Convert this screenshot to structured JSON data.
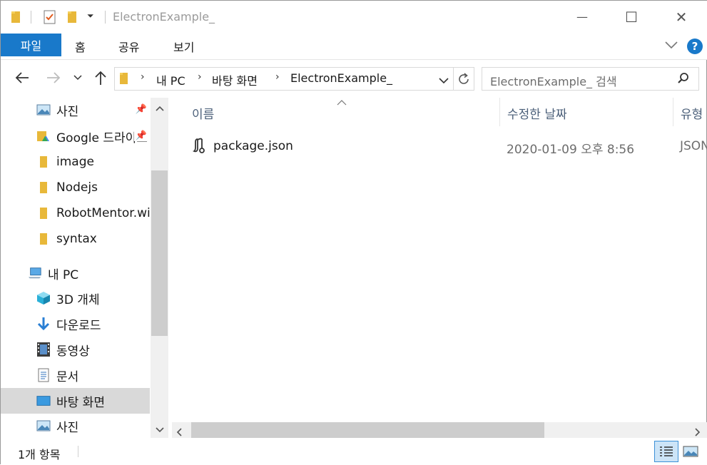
{
  "window": {
    "title": "ElectronExample_",
    "controls": {
      "minimize": "—",
      "maximize": "☐",
      "close": "✕"
    }
  },
  "ribbon": {
    "file_tab": "파일",
    "tabs": [
      "홈",
      "공유",
      "보기"
    ]
  },
  "address_bar": {
    "breadcrumbs": [
      "내 PC",
      "바탕 화면",
      "ElectronExample_"
    ]
  },
  "search": {
    "placeholder": "ElectronExample_ 검색"
  },
  "nav_pane": {
    "items": [
      {
        "label": "사진",
        "icon": "pictures-icon",
        "pinned": true
      },
      {
        "label": "Google 드라이브",
        "icon": "google-drive-icon",
        "pinned": true
      },
      {
        "label": "image",
        "icon": "folder-icon",
        "pinned": false
      },
      {
        "label": "Nodejs",
        "icon": "folder-icon",
        "pinned": false
      },
      {
        "label": "RobotMentor.wiki",
        "icon": "folder-icon",
        "pinned": false
      },
      {
        "label": "syntax",
        "icon": "folder-icon",
        "pinned": false
      },
      {
        "label": "내 PC",
        "icon": "pc-icon",
        "pinned": false
      },
      {
        "label": "3D 개체",
        "icon": "3d-objects-icon",
        "pinned": false
      },
      {
        "label": "다운로드",
        "icon": "downloads-icon",
        "pinned": false
      },
      {
        "label": "동영상",
        "icon": "videos-icon",
        "pinned": false
      },
      {
        "label": "문서",
        "icon": "documents-icon",
        "pinned": false
      },
      {
        "label": "바탕 화면",
        "icon": "desktop-icon",
        "pinned": false,
        "selected": true
      },
      {
        "label": "사진",
        "icon": "pictures-icon",
        "pinned": false
      }
    ]
  },
  "file_list": {
    "columns": [
      "이름",
      "수정한 날짜",
      "유형"
    ],
    "rows": [
      {
        "name": "package.json",
        "modified": "2020-01-09 오후 8:56",
        "type": "JSON"
      }
    ]
  },
  "status_bar": {
    "item_count": "1개 항목"
  },
  "colors": {
    "accent": "#1979ca",
    "selected": "#d9d9d9",
    "help": "#1979ca"
  }
}
